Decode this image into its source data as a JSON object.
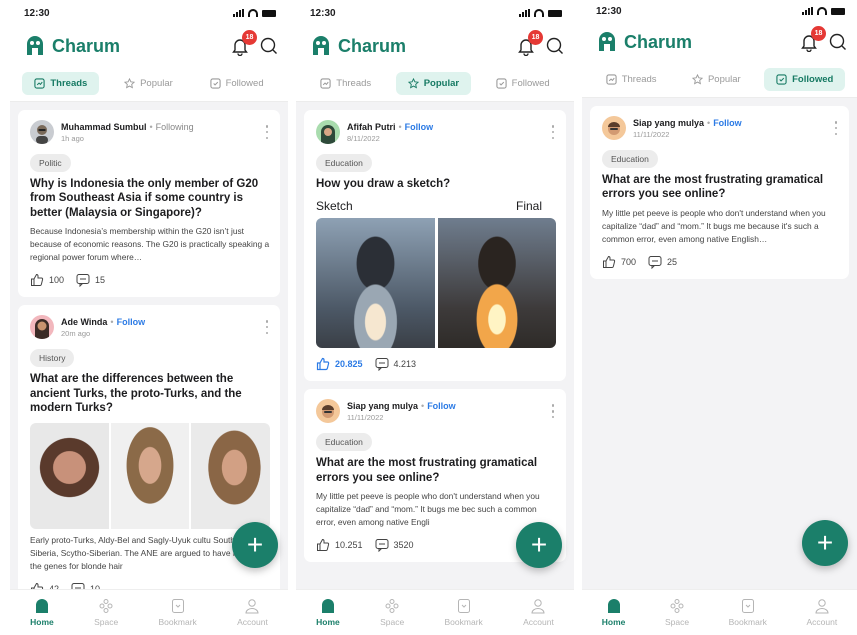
{
  "status": {
    "time": "12:30"
  },
  "app": {
    "name": "Charum",
    "notification_count": "18",
    "brand_color": "#1b7f6a",
    "accent_blue": "#2c7be5",
    "badge_color": "#e53935"
  },
  "tabs": {
    "threads": "Threads",
    "popular": "Popular",
    "followed": "Followed"
  },
  "nav": {
    "home": "Home",
    "space": "Space",
    "bookmark": "Bookmark",
    "account": "Account"
  },
  "screens": {
    "threads": {
      "posts": [
        {
          "author": "Muhammad Sumbul",
          "relation": "Following",
          "time": "1h ago",
          "tag": "Politic",
          "title": "Why is Indonesia the only member of G20 from Southeast Asia if some country is better (Malaysia or Singapore)?",
          "excerpt": "Because Indonesia’s membership within the G20 isn’t just because of economic reasons. The G20 is practically speaking a regional power forum where…",
          "likes": "100",
          "comments": "15"
        },
        {
          "author": "Ade Winda",
          "relation": "Follow",
          "time": "20m ago",
          "tag": "History",
          "title": "What are the differences between the ancient Turks, the proto-Turks, and the modern Turks?",
          "excerpt": "Early proto-Turks, Aldy-Bel and Sagly-Uyuk cultu Southern Siberia, Scytho-Siberian. The ANE are argued to have harbored the genes for blonde hair",
          "likes": "42",
          "comments": "10"
        }
      ]
    },
    "popular": {
      "posts": [
        {
          "author": "Afifah Putri",
          "relation": "Follow",
          "time": "8/11/2022",
          "tag": "Education",
          "title": "How you draw a sketch?",
          "label_left": "Sketch",
          "label_right": "Final",
          "likes": "20.825",
          "comments": "4.213"
        },
        {
          "author": "Siap yang mulya",
          "relation": "Follow",
          "time": "11/11/2022",
          "tag": "Education",
          "title": "What are the most frustrating gramatical errors you see online?",
          "excerpt": "My little pet peeve is people who don't understand when you capitalize “dad” and “mom.” It bugs me bec such a common error, even among native Engli",
          "likes": "10.251",
          "comments": "3520"
        }
      ]
    },
    "followed": {
      "posts": [
        {
          "author": "Siap yang mulya",
          "relation": "Follow",
          "time": "11/11/2022",
          "tag": "Education",
          "title": "What are the most frustrating gramatical errors you see online?",
          "excerpt": "My little pet peeve is people who don't understand when you capitalize “dad” and “mom.” It bugs me because it's such a common error, even among native English…",
          "likes": "700",
          "comments": "25"
        }
      ]
    }
  }
}
